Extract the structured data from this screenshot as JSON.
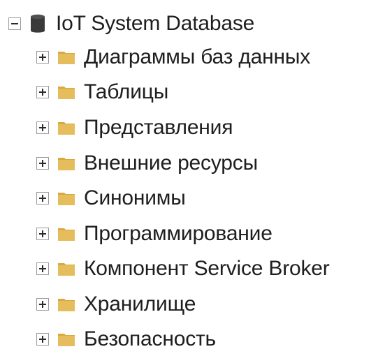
{
  "tree": {
    "root": {
      "label": "IoT System Database",
      "icon": "database-icon",
      "expanded": true
    },
    "children": [
      {
        "label": "Диаграммы баз данных",
        "icon": "folder-icon",
        "expanded": false
      },
      {
        "label": "Таблицы",
        "icon": "folder-icon",
        "expanded": false
      },
      {
        "label": "Представления",
        "icon": "folder-icon",
        "expanded": false
      },
      {
        "label": "Внешние ресурсы",
        "icon": "folder-icon",
        "expanded": false
      },
      {
        "label": "Синонимы",
        "icon": "folder-icon",
        "expanded": false
      },
      {
        "label": "Программирование",
        "icon": "folder-icon",
        "expanded": false
      },
      {
        "label": "Компонент Service Broker",
        "icon": "folder-icon",
        "expanded": false
      },
      {
        "label": "Хранилище",
        "icon": "folder-icon",
        "expanded": false
      },
      {
        "label": "Безопасность",
        "icon": "folder-icon",
        "expanded": false
      }
    ]
  },
  "colors": {
    "folder": "#e6bd5c",
    "folder_tab": "#d9a83f",
    "database": "#3a3a3a",
    "text": "#1e1e1e",
    "toggle_border": "#9a9a9a"
  }
}
